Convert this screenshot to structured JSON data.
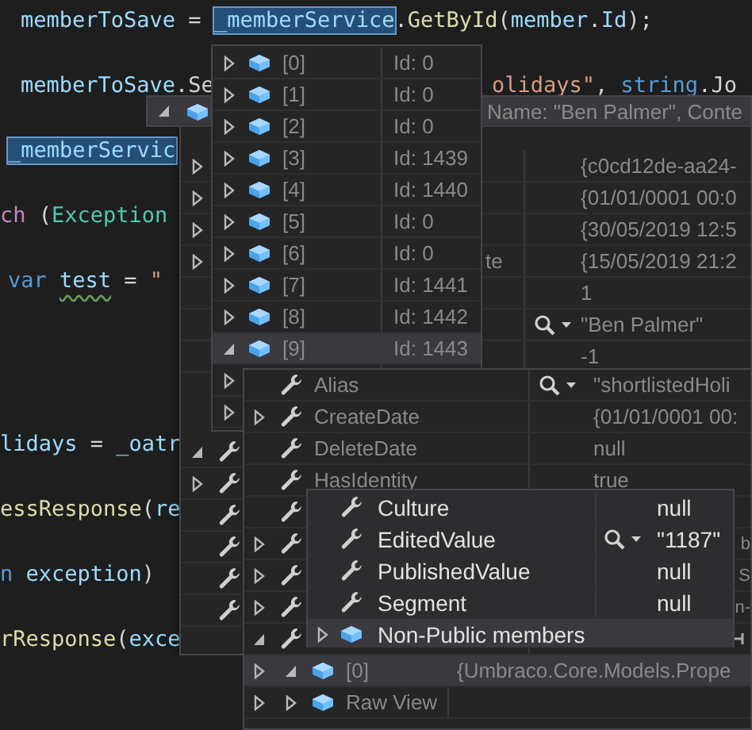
{
  "editor": {
    "lines": [
      {
        "tokens": [
          {
            "text": "memberToSave",
            "kind": "var"
          },
          {
            "text": " = ",
            "kind": "plain"
          },
          {
            "text": "_memberService",
            "kind": "selection"
          },
          {
            "text": ".",
            "kind": "plain"
          },
          {
            "text": "GetById",
            "kind": "method"
          },
          {
            "text": "(",
            "kind": "plain"
          },
          {
            "text": "member",
            "kind": "var"
          },
          {
            "text": ".",
            "kind": "plain"
          },
          {
            "text": "Id",
            "kind": "var"
          },
          {
            "text": ");",
            "kind": "plain"
          }
        ]
      },
      {
        "tokens": [
          {
            "text": "memberToSave",
            "kind": "var"
          },
          {
            "text": ".Se",
            "kind": "plain"
          }
        ],
        "tail": [
          {
            "text": "olidays\"",
            "kind": "string"
          },
          {
            "text": ", ",
            "kind": "plain"
          },
          {
            "text": "string",
            "kind": "keyword"
          },
          {
            "text": ".Jo",
            "kind": "plain"
          }
        ]
      },
      {
        "tokens": [
          {
            "text": "_memberServic",
            "kind": "selection"
          }
        ]
      },
      {
        "tokens": [
          {
            "text": "ch",
            "kind": "control"
          },
          {
            "text": " (",
            "kind": "plain"
          },
          {
            "text": "Exception",
            "kind": "type"
          }
        ]
      },
      {
        "tokens": [
          {
            "text": "var ",
            "kind": "keyword"
          },
          {
            "text": "test",
            "kind": "warning"
          },
          {
            "text": " = ",
            "kind": "plain"
          },
          {
            "text": "\"",
            "kind": "string"
          }
        ]
      },
      {
        "tokens": [
          {
            "text": "lidays",
            "kind": "var"
          },
          {
            "text": " = ",
            "kind": "plain"
          },
          {
            "text": "_oatr",
            "kind": "var"
          }
        ]
      },
      {
        "tokens": [
          {
            "text": "essResponse",
            "kind": "method"
          },
          {
            "text": "(",
            "kind": "plain"
          },
          {
            "text": "re",
            "kind": "var"
          }
        ]
      },
      {
        "tokens": [
          {
            "text": "n ",
            "kind": "keyword"
          },
          {
            "text": "exception",
            "kind": "var"
          },
          {
            "text": ")",
            "kind": "plain"
          }
        ]
      },
      {
        "tokens": [
          {
            "text": "rResponse",
            "kind": "method"
          },
          {
            "text": "(",
            "kind": "plain"
          },
          {
            "text": "exce",
            "kind": "var"
          }
        ]
      }
    ]
  },
  "datatips": [
    {
      "rows": [
        {
          "kind": "object",
          "expanded": false,
          "name": "[0]",
          "value": "Id: 0",
          "selected": false
        },
        {
          "kind": "object",
          "expanded": false,
          "name": "[1]",
          "value": "Id: 0",
          "selected": false
        },
        {
          "kind": "object",
          "expanded": false,
          "name": "[2]",
          "value": "Id: 0",
          "selected": false
        },
        {
          "kind": "object",
          "expanded": false,
          "name": "[3]",
          "value": "Id: 1439",
          "selected": false
        },
        {
          "kind": "object",
          "expanded": false,
          "name": "[4]",
          "value": "Id: 1440",
          "selected": false
        },
        {
          "kind": "object",
          "expanded": false,
          "name": "[5]",
          "value": "Id: 0",
          "selected": false
        },
        {
          "kind": "object",
          "expanded": false,
          "name": "[6]",
          "value": "Id: 0",
          "selected": false
        },
        {
          "kind": "object",
          "expanded": false,
          "name": "[7]",
          "value": "Id: 1441",
          "selected": false
        },
        {
          "kind": "object",
          "expanded": false,
          "name": "[8]",
          "value": "Id: 1442",
          "selected": false
        },
        {
          "kind": "object",
          "expanded": true,
          "name": "[9]",
          "value": "Id: 1443",
          "selected": true
        },
        {
          "kind": "plain",
          "expanded": false,
          "selected": false
        },
        {
          "kind": "plain",
          "expanded": false,
          "selected": false
        }
      ]
    },
    {
      "header": {
        "kind": "object",
        "expanded": true,
        "value": "Name: \"Ben Palmer\", Conte"
      },
      "rows": [
        {
          "kind": "plain",
          "expanded": false,
          "value": "{c0cd12de-aa24-",
          "selected": false
        },
        {
          "kind": "plain",
          "expanded": false,
          "value": "{01/01/0001 00:0",
          "selected": false
        },
        {
          "kind": "plain",
          "expanded": false,
          "value": "{30/05/2019 12:5",
          "selected": false
        },
        {
          "kind": "plain",
          "expanded": false,
          "name": "te",
          "value": "{15/05/2019 21:2",
          "selected": false
        },
        {
          "kind": "plain",
          "value": "1",
          "selected": false
        },
        {
          "kind": "plain",
          "visualizer": true,
          "value": "\"Ben Palmer\"",
          "selected": false
        },
        {
          "kind": "plain",
          "value": "-1",
          "selected": false
        }
      ],
      "lower_rows": [
        {
          "kind": "property",
          "expanded": true,
          "selected": false
        },
        {
          "kind": "property",
          "expanded": false,
          "selected": false
        },
        {
          "kind": "property",
          "selected": false
        },
        {
          "kind": "property",
          "selected": false
        },
        {
          "kind": "property",
          "selected": false
        },
        {
          "kind": "property",
          "selected": false
        }
      ]
    },
    {
      "rows": [
        {
          "kind": "property",
          "name": "Alias",
          "visualizer": true,
          "value": "\"shortlistedHoli",
          "selected": false
        },
        {
          "kind": "property",
          "expanded": false,
          "name": "CreateDate",
          "value": "{01/01/0001 00:",
          "selected": false
        },
        {
          "kind": "property",
          "name": "DeleteDate",
          "value": "null",
          "selected": false
        },
        {
          "kind": "property",
          "name": "HasIdentity",
          "value": "true",
          "selected": false
        },
        {
          "kind": "property",
          "selected": false
        },
        {
          "kind": "property",
          "expanded": false,
          "value_tail": "b",
          "selected": false
        },
        {
          "kind": "property",
          "expanded": false,
          "value_tail": "S",
          "selected": false
        },
        {
          "kind": "property",
          "expanded": false,
          "value_tail": "n-",
          "selected": false
        },
        {
          "kind": "property",
          "expanded": true,
          "pin": true,
          "selected": false
        },
        {
          "kind": "child",
          "lead_expanded": false,
          "expanded": true,
          "name": "[0]",
          "value": "{Umbraco.Core.Models.Prope",
          "selected": true
        },
        {
          "kind": "child",
          "lead_expanded": false,
          "expanded": false,
          "name": "Raw View",
          "selected": false
        }
      ]
    },
    {
      "rows": [
        {
          "kind": "property",
          "name": "Culture",
          "value": "null",
          "selected": false
        },
        {
          "kind": "property",
          "name": "EditedValue",
          "visualizer": true,
          "value": "\"1187\"",
          "selected": false
        },
        {
          "kind": "property",
          "name": "PublishedValue",
          "value": "null",
          "selected": false
        },
        {
          "kind": "property",
          "name": "Segment",
          "value": "null",
          "selected": false
        },
        {
          "kind": "object",
          "expanded": false,
          "name": "Non-Public members",
          "selected": true
        }
      ]
    }
  ]
}
